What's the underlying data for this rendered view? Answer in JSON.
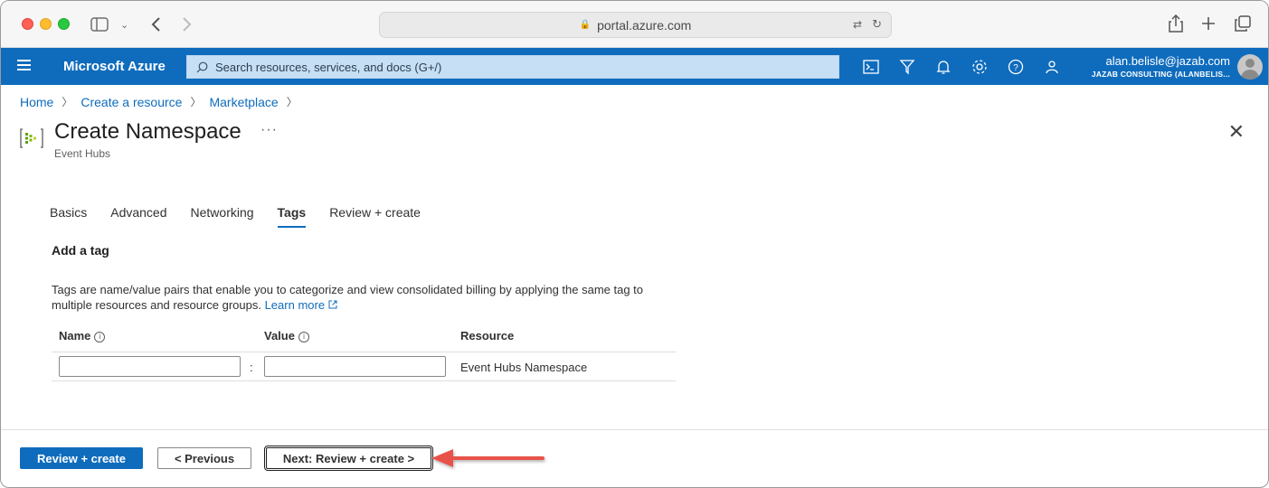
{
  "browser": {
    "url": "portal.azure.com"
  },
  "header": {
    "brand": "Microsoft Azure",
    "search_placeholder": "Search resources, services, and docs (G+/)",
    "user_email": "alan.belisle@jazab.com",
    "user_tenant": "JAZAB CONSULTING (ALANBELIS..."
  },
  "breadcrumb": [
    "Home",
    "Create a resource",
    "Marketplace"
  ],
  "page": {
    "title": "Create Namespace",
    "subtitle": "Event Hubs",
    "more": "···"
  },
  "tabs": [
    {
      "label": "Basics",
      "active": false
    },
    {
      "label": "Advanced",
      "active": false
    },
    {
      "label": "Networking",
      "active": false
    },
    {
      "label": "Tags",
      "active": true
    },
    {
      "label": "Review + create",
      "active": false
    }
  ],
  "tags_section": {
    "title": "Add a tag",
    "description": "Tags are name/value pairs that enable you to categorize and view consolidated billing by applying the same tag to multiple resources and resource groups.",
    "learn_more": "Learn more",
    "columns": {
      "name": "Name",
      "value": "Value",
      "resource": "Resource"
    },
    "row": {
      "name": "",
      "value": "",
      "separator": ":",
      "resource": "Event Hubs Namespace"
    }
  },
  "footer": {
    "review_create": "Review + create",
    "previous": "< Previous",
    "next": "Next: Review + create >"
  },
  "colors": {
    "azure_blue": "#0f6cbd",
    "annotation_arrow": "#e8524a"
  }
}
